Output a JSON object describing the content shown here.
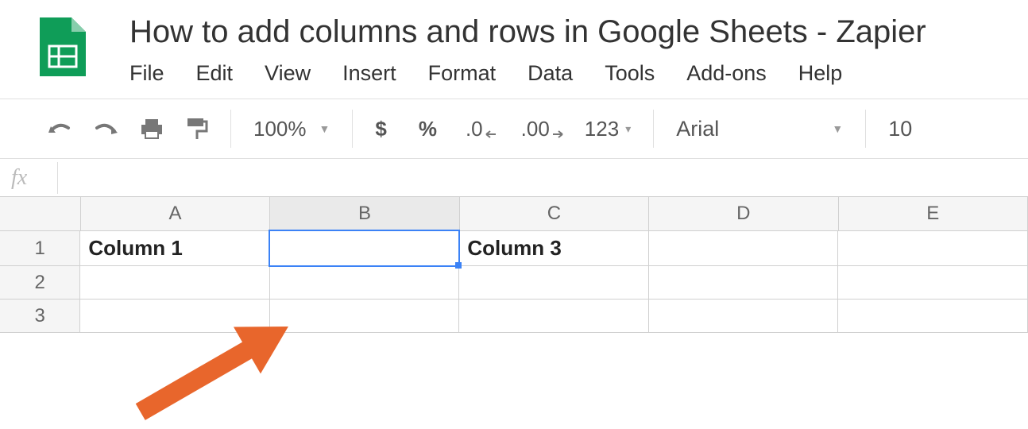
{
  "doc_title": "How to add columns and rows in Google Sheets - Zapier",
  "menu": {
    "file": "File",
    "edit": "Edit",
    "view": "View",
    "insert": "Insert",
    "format": "Format",
    "data": "Data",
    "tools": "Tools",
    "addons": "Add-ons",
    "help": "Help"
  },
  "toolbar": {
    "zoom": "100%",
    "currency": "$",
    "percent": "%",
    "dec_less": ".0",
    "dec_more": ".00",
    "num_format": "123",
    "font": "Arial",
    "font_size": "10"
  },
  "formula_bar": {
    "fx_label": "fx",
    "value": ""
  },
  "sheet": {
    "columns": [
      "A",
      "B",
      "C",
      "D",
      "E"
    ],
    "selected_col_index": 1,
    "rows": [
      {
        "num": "1",
        "cells": [
          "Column 1",
          "",
          "Column 3",
          "",
          ""
        ]
      },
      {
        "num": "2",
        "cells": [
          "",
          "",
          "",
          "",
          ""
        ]
      },
      {
        "num": "3",
        "cells": [
          "",
          "",
          "",
          "",
          ""
        ]
      }
    ],
    "selected_cell": {
      "row": 0,
      "col": 1
    }
  },
  "annotation_arrow_color": "#e8662c"
}
